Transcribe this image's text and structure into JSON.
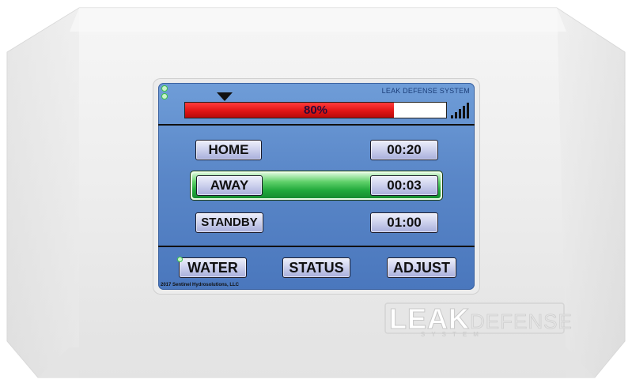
{
  "screen": {
    "title": "LEAK DEFENSE SYSTEM",
    "pressure": {
      "percent": 80,
      "label": "80%"
    },
    "signal_icon": "signal-strength-icon",
    "status_led_icon": "indicator-led-icon"
  },
  "modes": [
    {
      "label": "HOME",
      "timer": "00:20",
      "active": false
    },
    {
      "label": "AWAY",
      "timer": "00:03",
      "active": true
    },
    {
      "label": "STANDBY",
      "timer": "01:00",
      "active": false
    }
  ],
  "nav": {
    "water": "WATER",
    "status": "STATUS",
    "adjust": "ADJUST"
  },
  "footer": {
    "copyright": "2017 Sentinel Hydrosolutions, LLC"
  },
  "brand": {
    "leak": "LEAK",
    "defense": "DEFENSE",
    "system": "SYSTEM"
  },
  "colors": {
    "bar_fill": "#e01515",
    "active_mode": "#1fa83a",
    "screen_bg": "#5a87c8",
    "led": "#3cc24a"
  }
}
